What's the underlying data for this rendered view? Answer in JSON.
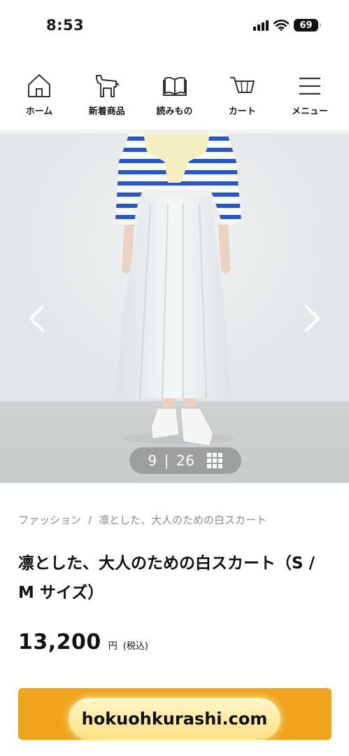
{
  "status": {
    "time": "8:53",
    "battery": "69"
  },
  "nav": {
    "items": [
      {
        "label": "ホーム",
        "icon": "home-icon"
      },
      {
        "label": "新着商品",
        "icon": "horse-icon"
      },
      {
        "label": "読みもの",
        "icon": "book-icon"
      },
      {
        "label": "カート",
        "icon": "cart-icon"
      },
      {
        "label": "メニュー",
        "icon": "menu-icon"
      }
    ]
  },
  "gallery": {
    "current": "9",
    "separator": "|",
    "total": "26"
  },
  "breadcrumb": {
    "parent": "ファッション",
    "separator": "/",
    "current": "凛とした、大人のための白スカート"
  },
  "product": {
    "title": "凛とした、大人のための白スカート（S / M サイズ）",
    "price": "13,200",
    "currency": "円",
    "tax": "(税込)"
  },
  "watermark": {
    "text": "hokuohkurashi.com"
  },
  "colors": {
    "accent": "#f0a31c",
    "stripe": "#2a55c8"
  }
}
